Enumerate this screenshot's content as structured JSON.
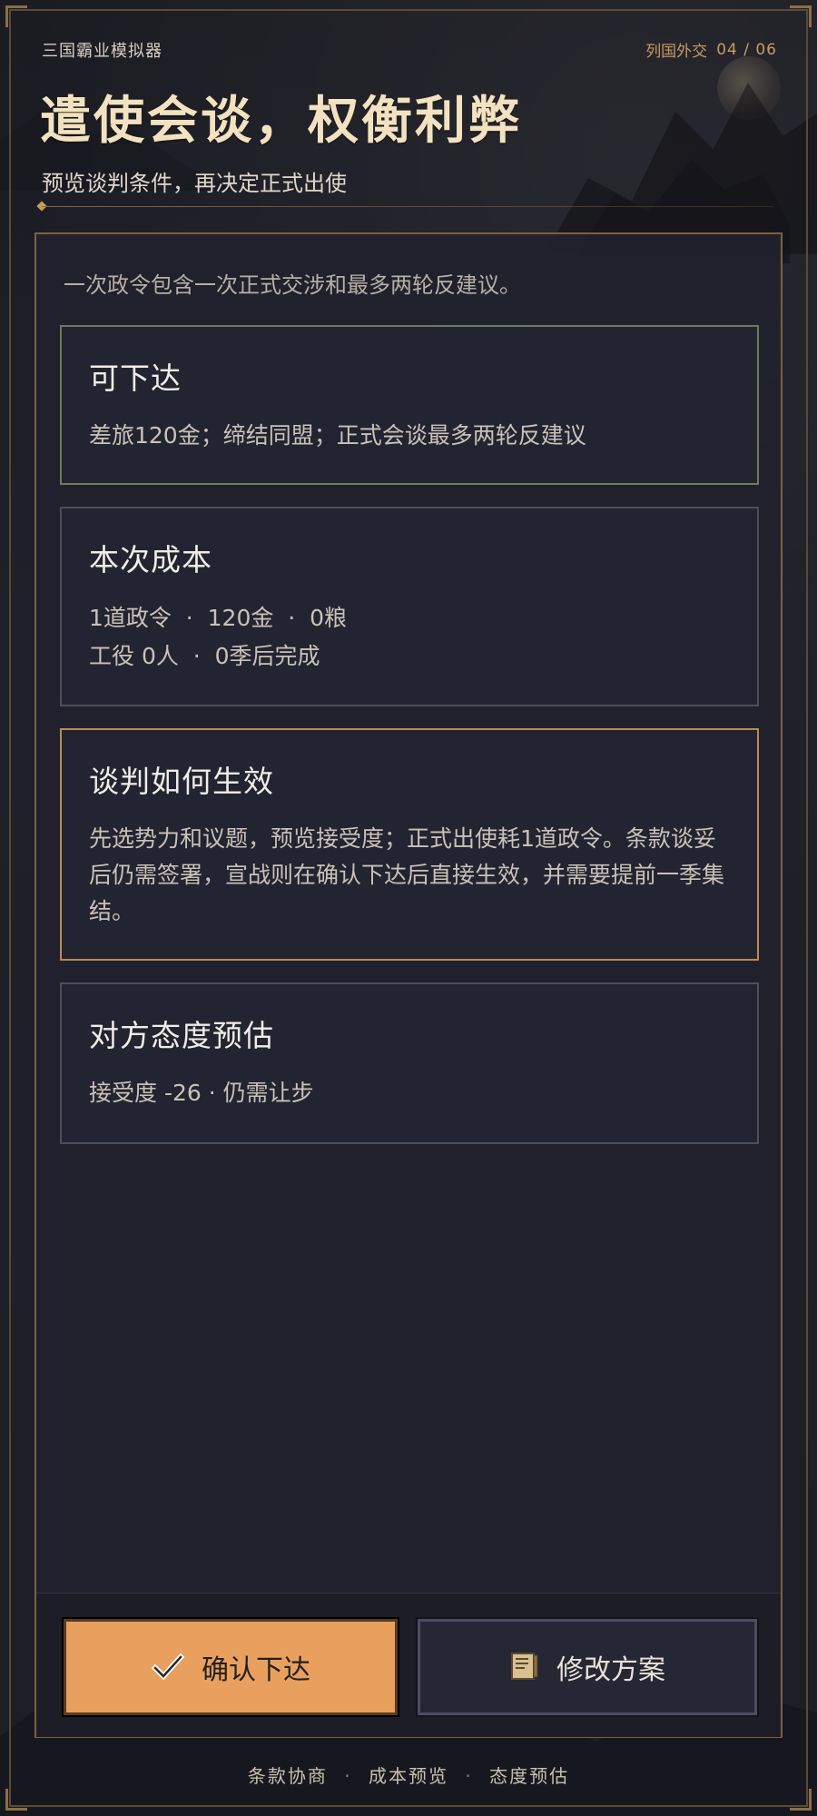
{
  "header": {
    "app_title": "三国霸业模拟器",
    "section_label": "列国外交",
    "page_indicator": "04 / 06",
    "title": "遣使会谈，权衡利弊",
    "subtitle": "预览谈判条件，再决定正式出使"
  },
  "panel": {
    "description": "一次政令包含一次正式交涉和最多两轮反建议。",
    "cards": [
      {
        "title": "可下达",
        "text": "差旅120金；缔结同盟；正式会谈最多两轮反建议"
      },
      {
        "title": "本次成本",
        "lines": [
          "1道政令  ·  120金  ·  0粮",
          "工役 0人  ·  0季后完成"
        ]
      },
      {
        "title": "谈判如何生效",
        "text": "先选势力和议题，预览接受度；正式出使耗1道政令。条款谈妥后仍需签署，宣战则在确认下达后直接生效，并需要提前一季集结。"
      },
      {
        "title": "对方态度预估",
        "text": "接受度 -26  ·  仍需让步"
      }
    ]
  },
  "actions": {
    "confirm_label": "确认下达",
    "modify_label": "修改方案"
  },
  "footer": {
    "items": [
      "条款协商",
      "成本预览",
      "态度预估"
    ]
  },
  "icons": {
    "confirm": "checkmark-icon",
    "modify": "scroll-icon"
  },
  "colors": {
    "accent": "#e9a05f",
    "title": "#f3e2bf",
    "border_gold": "#bd8a4f",
    "border_green": "#6f7c58",
    "panel_bg": "#21222e"
  }
}
